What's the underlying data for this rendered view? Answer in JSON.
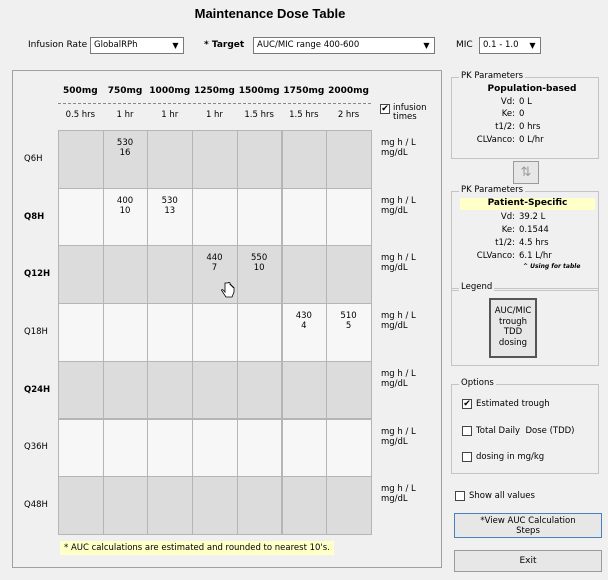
{
  "title": "Maintenance Dose Table",
  "top": {
    "infusion_rate_label": "Infusion Rate",
    "infusion_rate_value": "GlobalRPh",
    "target_label": "* Target",
    "target_value": "AUC/MIC range 400-600",
    "mic_label": "MIC",
    "mic_value": "0.1 - 1.0"
  },
  "doses": [
    "500mg",
    "750mg",
    "1000mg",
    "1250mg",
    "1500mg",
    "1750mg",
    "2000mg"
  ],
  "times": [
    "0.5 hrs",
    "1 hr",
    "1 hr",
    "1 hr",
    "1.5 hrs",
    "1.5 hrs",
    "2 hrs"
  ],
  "infusion_times_label": "infusion\ntimes",
  "rows": [
    {
      "label": "Q6H",
      "bold": false
    },
    {
      "label": "Q8H",
      "bold": true
    },
    {
      "label": "Q12H",
      "bold": true
    },
    {
      "label": "Q18H",
      "bold": false
    },
    {
      "label": "Q24H",
      "bold": true
    },
    {
      "label": "Q36H",
      "bold": false
    },
    {
      "label": "Q48H",
      "bold": false
    }
  ],
  "cells": [
    {
      "row": 0,
      "col": 1,
      "auc": "530",
      "trough": "16"
    },
    {
      "row": 1,
      "col": 1,
      "auc": "400",
      "trough": "10"
    },
    {
      "row": 1,
      "col": 2,
      "auc": "530",
      "trough": "13"
    },
    {
      "row": 2,
      "col": 3,
      "auc": "440",
      "trough": "7"
    },
    {
      "row": 2,
      "col": 4,
      "auc": "550",
      "trough": "10"
    },
    {
      "row": 3,
      "col": 5,
      "auc": "430",
      "trough": "4"
    },
    {
      "row": 3,
      "col": 6,
      "auc": "510",
      "trough": "5"
    }
  ],
  "unit_line1": "mg h / L",
  "unit_line2": "mg/dL",
  "footnote": "* AUC calculations are estimated and rounded to nearest 10's.",
  "pk_pop": {
    "group_title": "PK Parameters",
    "heading": "Population-based",
    "vd_label": "Vd:",
    "vd": "0 L",
    "ke_label": "Ke:",
    "ke": "0",
    "t12_label": "t1/2:",
    "t12": "0 hrs",
    "cl_label": "CLVanco:",
    "cl": "0 L/hr"
  },
  "swap_icon": "⇅",
  "pk_pat": {
    "group_title": "PK Parameters",
    "heading": "Patient-Specific",
    "vd_label": "Vd:",
    "vd": "39.2 L",
    "ke_label": "Ke:",
    "ke": "0.1544",
    "t12_label": "t1/2:",
    "t12": "4.5 hrs",
    "cl_label": "CLVanco:",
    "cl": "6.1 L/hr",
    "using_note": "^ Using for table"
  },
  "legend": {
    "group_title": "Legend",
    "line1": "AUC/MIC",
    "line2": "trough",
    "line3": "TDD",
    "line4": "dosing"
  },
  "options": {
    "group_title": "Options",
    "estimated_trough": "Estimated trough",
    "tdd": "Total Daily  Dose (TDD)",
    "mgkg": "dosing in mg/kg"
  },
  "show_all": "Show all values",
  "view_auc": "*View AUC Calculation\nSteps",
  "exit": "Exit",
  "checkmark": "✔",
  "dropdown_arrow": "▼"
}
